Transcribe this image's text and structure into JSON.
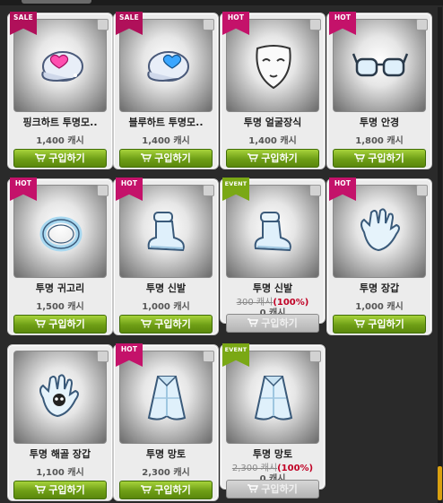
{
  "colors": {
    "buy_green": "#7aa815",
    "ribbon_hot": "#c4126a",
    "ribbon_sale": "#b0105a",
    "ribbon_event": "#7aa815",
    "discount_red": "#c00024",
    "scroll_thumb": "#d9a010"
  },
  "items": [
    {
      "badge": "SALE",
      "icon": "pink-heart-cap-icon",
      "name": "핑크하트 투명모..",
      "price": "1,400 캐시",
      "buy": "구입하기",
      "enabled": true
    },
    {
      "badge": "SALE",
      "icon": "blue-heart-cap-icon",
      "name": "블루하트 투명모..",
      "price": "1,400 캐시",
      "buy": "구입하기",
      "enabled": true
    },
    {
      "badge": "HOT",
      "icon": "mask-icon",
      "name": "투명 얼굴장식",
      "price": "1,400 캐시",
      "buy": "구입하기",
      "enabled": true
    },
    {
      "badge": "HOT",
      "icon": "glasses-icon",
      "name": "투명 안경",
      "price": "1,800 캐시",
      "buy": "구입하기",
      "enabled": true
    },
    {
      "badge": "HOT",
      "icon": "earring-icon",
      "name": "투명 귀고리",
      "price": "1,500 캐시",
      "buy": "구입하기",
      "enabled": true
    },
    {
      "badge": "HOT",
      "icon": "shoes-icon",
      "name": "투명 신발",
      "price": "1,000 캐시",
      "buy": "구입하기",
      "enabled": true
    },
    {
      "badge": "EVENT",
      "icon": "shoes-icon",
      "name": "투명 신발",
      "orig_price": "300 캐시",
      "discount": "(100%)",
      "price": "0 캐시",
      "buy": "구입하기",
      "enabled": false
    },
    {
      "badge": "HOT",
      "icon": "glove-icon",
      "name": "투명 장갑",
      "price": "1,000 캐시",
      "buy": "구입하기",
      "enabled": true
    },
    {
      "badge": "",
      "icon": "skull-glove-icon",
      "name": "투명 해골 장갑",
      "price": "1,100 캐시",
      "buy": "구입하기",
      "enabled": true
    },
    {
      "badge": "HOT",
      "icon": "cape-icon",
      "name": "투명 망토",
      "price": "2,300 캐시",
      "buy": "구입하기",
      "enabled": true
    },
    {
      "badge": "EVENT",
      "icon": "cape-icon",
      "name": "투명 망토",
      "orig_price": "2,300 캐시",
      "discount": "(100%)",
      "price": "0 캐시",
      "buy": "구입하기",
      "enabled": false
    }
  ]
}
